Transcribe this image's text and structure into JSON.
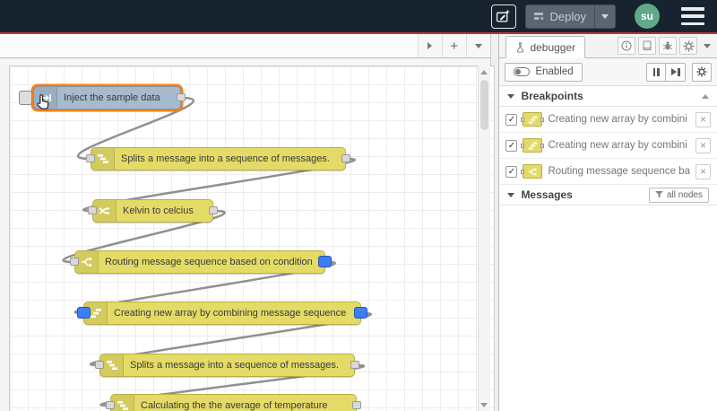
{
  "header": {
    "assistant_button": {
      "icon": "edit-sparkle-icon"
    },
    "deploy": {
      "label": "Deploy",
      "icon": "deploy-icon"
    },
    "user": {
      "initials": "su"
    }
  },
  "workspace": {
    "nodes": [
      {
        "label": "Inject the sample data",
        "type": "inject",
        "icon": "inject-icon",
        "selected": true
      },
      {
        "label": "Splits a message into a sequence of messages.",
        "type": "split",
        "icon": "split-icon"
      },
      {
        "label": "Kelvin to celcius",
        "type": "function",
        "icon": "shuffle-icon"
      },
      {
        "label": "Routing message sequence based on condition",
        "type": "switch",
        "icon": "switch-icon",
        "breakpoint_out": true
      },
      {
        "label": "Creating new array by combining message sequence",
        "type": "join",
        "icon": "join-icon",
        "breakpoint_in": true,
        "breakpoint_out": true
      },
      {
        "label": "Splits a message into a sequence of messages.",
        "type": "split",
        "icon": "split-icon"
      },
      {
        "label": "Calculating the the average of temperature",
        "type": "function",
        "icon": "split-icon"
      }
    ]
  },
  "sidebar": {
    "tab_label": "debugger",
    "toolbar": {
      "enabled_label": "Enabled"
    },
    "breakpoints": {
      "title": "Breakpoints",
      "items": [
        {
          "label": "Creating new array by combini",
          "icon": "join-icon",
          "checked": true
        },
        {
          "label": "Creating new array by combini",
          "icon": "join-icon",
          "checked": true
        },
        {
          "label": "Routing message sequence ba",
          "icon": "switch-icon",
          "checked": true
        }
      ]
    },
    "messages": {
      "title": "Messages",
      "filter_label": "all nodes"
    }
  },
  "icons": {
    "plus": "+",
    "close": "×",
    "check": "✓"
  },
  "colors": {
    "header_bg": "#172430",
    "alert_line": "#bd3434",
    "node_yellow": "#e4db66",
    "node_inject": "#a7bbcf",
    "selection_orange": "#ff7f0e",
    "breakpoint_blue": "#3d7df5",
    "wire_gray": "#909090",
    "avatar_green": "#62a98c"
  }
}
